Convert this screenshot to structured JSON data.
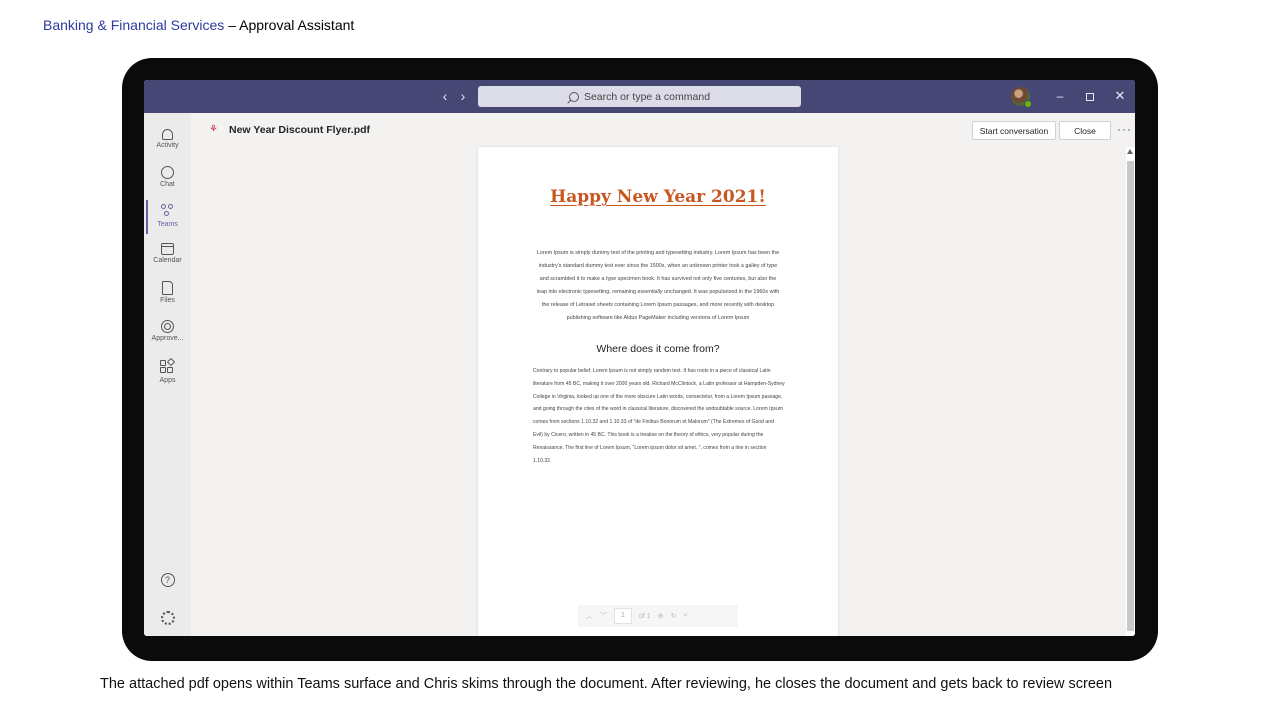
{
  "slide": {
    "title_accent": "Banking & Financial Services",
    "title_rest": " – Approval Assistant",
    "caption": "The attached pdf opens within Teams surface and Chris skims through the document. After reviewing, he closes the document and gets back to review screen"
  },
  "titlebar": {
    "back_icon": "‹",
    "forward_icon": "›",
    "search_placeholder": "Search or type a command",
    "minimize_icon": "–",
    "close_icon": "✕"
  },
  "rail": {
    "items": [
      {
        "label": "Activity",
        "icon": "bell-icon"
      },
      {
        "label": "Chat",
        "icon": "chat-icon"
      },
      {
        "label": "Teams",
        "icon": "teams-icon"
      },
      {
        "label": "Calendar",
        "icon": "calendar-icon"
      },
      {
        "label": "Files",
        "icon": "file-icon"
      },
      {
        "label": "Approve...",
        "icon": "approvals-icon"
      },
      {
        "label": "Apps",
        "icon": "apps-icon"
      }
    ],
    "help_icon": "?",
    "settings_icon": "gear-icon"
  },
  "file": {
    "name": "New Year Discount Flyer.pdf",
    "start_conversation": "Start conversation",
    "close": "Close",
    "more": "···"
  },
  "pdf": {
    "title": "Happy New Year 2021!",
    "paragraph1": "Lorem Ipsum is simply dummy text of the printing and typesetting industry. Lorem Ipsum has been the industry's standard dummy text ever since the 1500s, when an unknown printer took a galley of type and scrambled it to make a type specimen book. It has survived not only five centuries, but also the leap into electronic typesetting, remaining essentially unchanged. It was popularized in the 1960s with the release of Letraset sheets containing Lorem Ipsum passages, and more recently with desktop publishing software like Aldus PageMaker including versions of Lorem Ipsum",
    "heading2": "Where does it come from?",
    "paragraph2": "Contrary to popular belief, Lorem Ipsum is not simply random text. It has roots in a piece of classical Latin literature from 45 BC, making it over 2000 years old. Richard McClintock, a Latin professor at Hampden-Sydney College in Virginia, looked up one of the more obscure Latin words, consectetur, from a Lorem Ipsum passage, and going through the cites of the word in classical literature, discovered the undoubtable source. Lorem Ipsum comes from sections 1.10.32 and 1.10.33 of \"de Finibus Bonorum et Malorum\" (The Extremes of Good and Evil) by Cicero, written in 45 BC. This book is a treatise on the theory of ethics, very popular during the Renaissance. The first line of Lorem Ipsum, \"Lorem ipsum dolor sit amet..\", comes from a line in section 1.10.32.",
    "page_current": "1",
    "page_total": "of 1"
  },
  "colors": {
    "teams_purple": "#464775",
    "accent": "#6264a7",
    "flyer_title": "#c8571f",
    "slide_title_accent": "#2e3a9e"
  }
}
